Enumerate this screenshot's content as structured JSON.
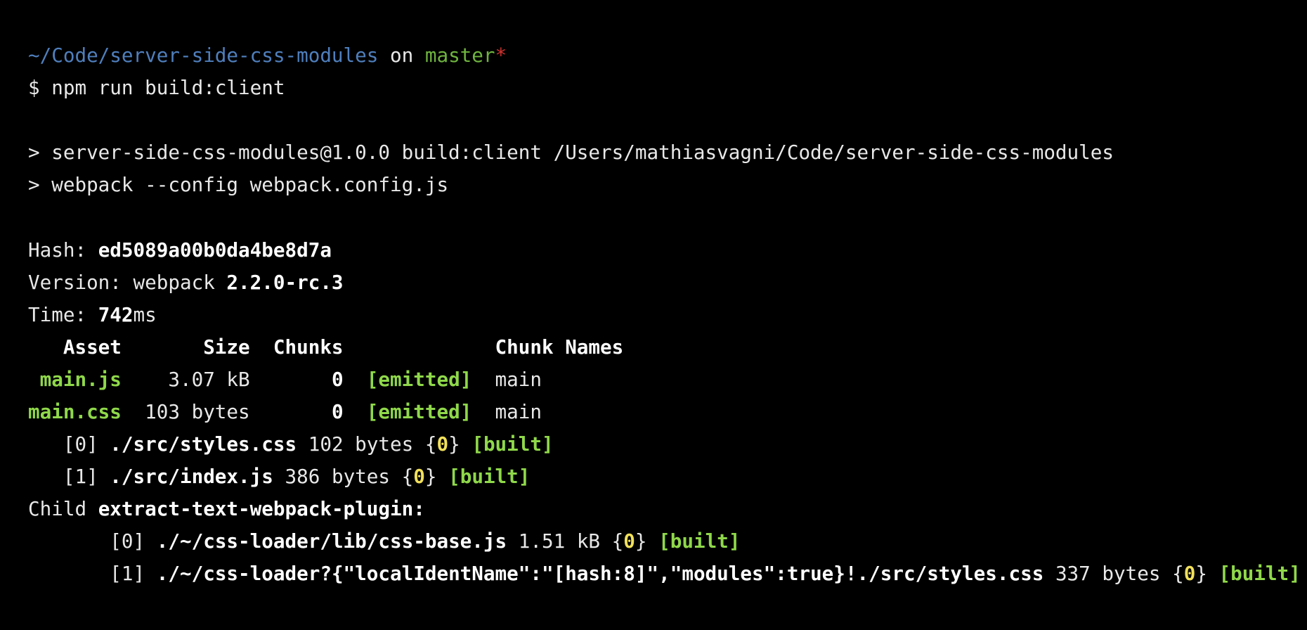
{
  "prompt": {
    "path": "~/Code/server-side-css-modules",
    "on": " on ",
    "branch": "master",
    "dirty_marker": "*"
  },
  "command": {
    "prefix": "$ ",
    "text": "npm run build:client"
  },
  "script_lines": [
    "> server-side-css-modules@1.0.0 build:client /Users/mathiasvagni/Code/server-side-css-modules",
    "> webpack --config webpack.config.js"
  ],
  "summary": {
    "hash_label": "Hash: ",
    "hash_value": "ed5089a00b0da4be8d7a",
    "version_label": "Version: webpack ",
    "version_value": "2.2.0-rc.3",
    "time_label": "Time: ",
    "time_value": "742",
    "time_unit": "ms"
  },
  "asset_table": {
    "header": "   Asset       Size  Chunks             Chunk Names",
    "rows": [
      {
        "asset": " main.js",
        "size": "    3.07 kB",
        "chunks": "       0",
        "status": "  [emitted]",
        "names": "  main"
      },
      {
        "asset": "main.css",
        "size": "  103 bytes",
        "chunks": "       0",
        "status": "  [emitted]",
        "names": "  main"
      }
    ]
  },
  "modules": [
    {
      "index": "   [0] ",
      "path": "./src/styles.css",
      "size": " 102 bytes {",
      "chunk": "0",
      "close": "} ",
      "status": "[built]"
    },
    {
      "index": "   [1] ",
      "path": "./src/index.js",
      "size": " 386 bytes {",
      "chunk": "0",
      "close": "} ",
      "status": "[built]"
    }
  ],
  "child": {
    "label": "Child ",
    "name": "extract-text-webpack-plugin",
    "colon": ":",
    "modules": [
      {
        "index": "       [0] ",
        "path": "./~/css-loader/lib/css-base.js",
        "size": " 1.51 kB {",
        "chunk": "0",
        "close": "} ",
        "status": "[built]"
      },
      {
        "index": "       [1] ",
        "path": "./~/css-loader?{\"localIdentName\":\"[hash:8]\",\"modules\":true}!./src/styles.css",
        "size": " 337 bytes {",
        "chunk": "0",
        "close": "} ",
        "status": "[built]"
      }
    ]
  },
  "colors": {
    "background": "#000000",
    "path": "#4f7fbd",
    "branch": "#6fb43f",
    "dirty": "#d0322e",
    "built_emitted": "#8fd84a",
    "chunk_id": "#f1e05a"
  }
}
